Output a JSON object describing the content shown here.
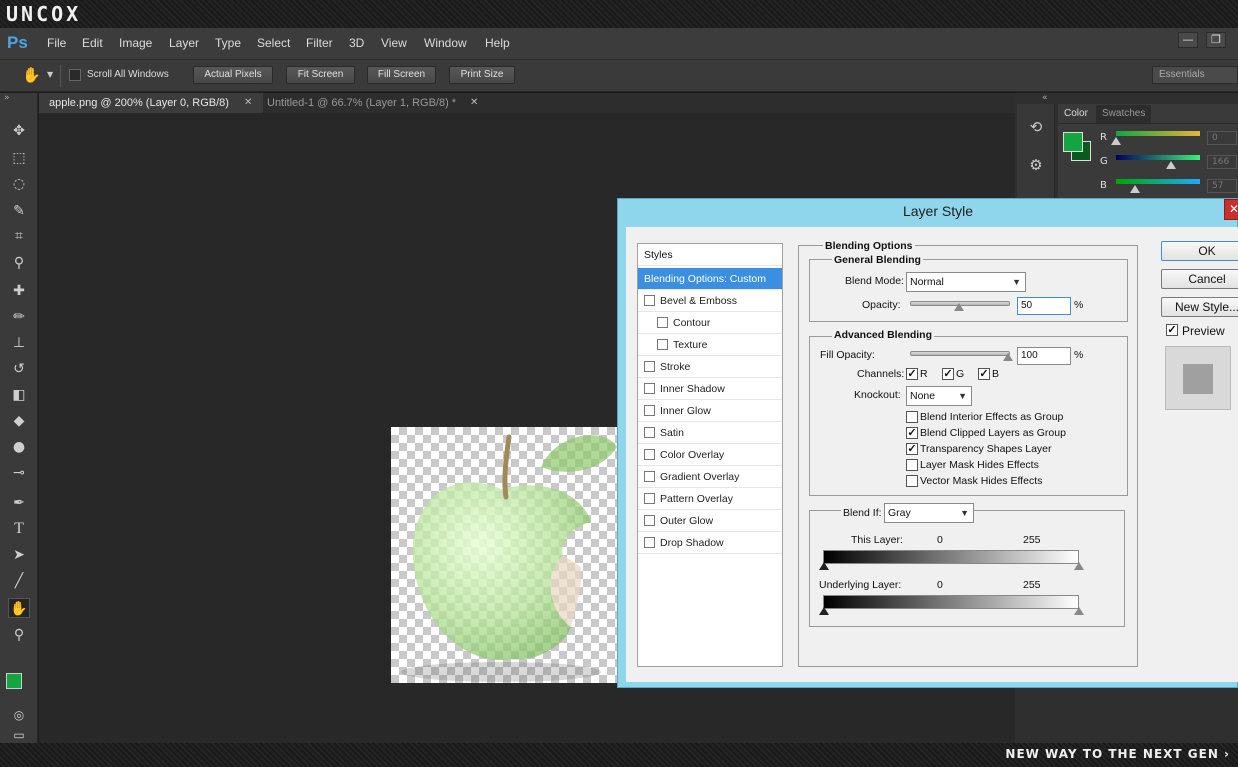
{
  "banner": {
    "logo": "UNCOX",
    "slogan": "NEW WAY TO THE NEXT GEN ›"
  },
  "app": {
    "logo": "Ps",
    "menu": [
      "File",
      "Edit",
      "Image",
      "Layer",
      "Type",
      "Select",
      "Filter",
      "3D",
      "View",
      "Window",
      "Help"
    ],
    "window_controls": {
      "minimize": "—",
      "restore": "❐"
    }
  },
  "options": {
    "scroll_all_windows": "Scroll All Windows",
    "scroll_all_checked": false,
    "buttons": [
      "Actual Pixels",
      "Fit Screen",
      "Fill Screen",
      "Print Size"
    ],
    "workspace": "Essentials"
  },
  "tabs": [
    {
      "label": "apple.png @ 200% (Layer 0, RGB/8)",
      "active": true
    },
    {
      "label": "Untitled-1 @ 66.7% (Layer 1, RGB/8) *",
      "active": false
    }
  ],
  "panels": {
    "color_tab": "Color",
    "swatches_tab": "Swatches",
    "fg_color": "#13a53f",
    "bg_color": "#0a5a1e",
    "channels": [
      {
        "label": "R",
        "value": "0",
        "level": 0
      },
      {
        "label": "G",
        "value": "166",
        "level": 0.65
      },
      {
        "label": "B",
        "value": "57",
        "level": 0.22
      }
    ]
  },
  "dialog": {
    "title": "Layer Style",
    "close": "✕",
    "styles_header": "Styles",
    "styles": [
      {
        "label": "Blending Options: Custom",
        "checkbox": false,
        "selected": true,
        "indent": false
      },
      {
        "label": "Bevel & Emboss",
        "checkbox": true,
        "selected": false,
        "indent": false
      },
      {
        "label": "Contour",
        "checkbox": true,
        "selected": false,
        "indent": true
      },
      {
        "label": "Texture",
        "checkbox": true,
        "selected": false,
        "indent": true
      },
      {
        "label": "Stroke",
        "checkbox": true,
        "selected": false,
        "indent": false
      },
      {
        "label": "Inner Shadow",
        "checkbox": true,
        "selected": false,
        "indent": false
      },
      {
        "label": "Inner Glow",
        "checkbox": true,
        "selected": false,
        "indent": false
      },
      {
        "label": "Satin",
        "checkbox": true,
        "selected": false,
        "indent": false
      },
      {
        "label": "Color Overlay",
        "checkbox": true,
        "selected": false,
        "indent": false
      },
      {
        "label": "Gradient Overlay",
        "checkbox": true,
        "selected": false,
        "indent": false
      },
      {
        "label": "Pattern Overlay",
        "checkbox": true,
        "selected": false,
        "indent": false
      },
      {
        "label": "Outer Glow",
        "checkbox": true,
        "selected": false,
        "indent": false
      },
      {
        "label": "Drop Shadow",
        "checkbox": true,
        "selected": false,
        "indent": false
      }
    ],
    "blending_options": {
      "title": "Blending Options",
      "general_title": "General Blending",
      "blend_mode_label": "Blend Mode:",
      "blend_mode": "Normal",
      "opacity_label": "Opacity:",
      "opacity_value": "50",
      "opacity_level": 0.5,
      "percent": "%",
      "advanced_title": "Advanced Blending",
      "fill_opacity_label": "Fill Opacity:",
      "fill_opacity_value": "100",
      "fill_opacity_level": 1.0,
      "channels_label": "Channels:",
      "channels": [
        {
          "label": "R",
          "checked": true
        },
        {
          "label": "G",
          "checked": true
        },
        {
          "label": "B",
          "checked": true
        }
      ],
      "knockout_label": "Knockout:",
      "knockout": "None",
      "options": [
        {
          "label": "Blend Interior Effects as Group",
          "checked": false
        },
        {
          "label": "Blend Clipped Layers as Group",
          "checked": true
        },
        {
          "label": "Transparency Shapes Layer",
          "checked": true
        },
        {
          "label": "Layer Mask Hides Effects",
          "checked": false
        },
        {
          "label": "Vector Mask Hides Effects",
          "checked": false
        }
      ],
      "blend_if_label": "Blend If:",
      "blend_if": "Gray",
      "this_layer_label": "This Layer:",
      "this_layer_min": "0",
      "this_layer_max": "255",
      "underlying_label": "Underlying Layer:",
      "underlying_min": "0",
      "underlying_max": "255"
    },
    "buttons": {
      "ok": "OK",
      "cancel": "Cancel",
      "new_style": "New Style..."
    },
    "preview_label": "Preview",
    "preview_checked": true
  }
}
